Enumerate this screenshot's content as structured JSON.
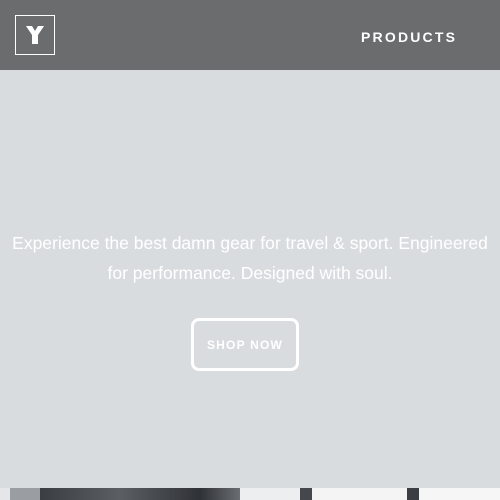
{
  "header": {
    "logo_icon": "brand-y-logo-icon",
    "nav": {
      "products_label": "PRODUCTS"
    },
    "background_color": "#6b6c6e"
  },
  "hero": {
    "tagline": "Experience the best damn gear for travel & sport. Engineered for performance. Designed with soul.",
    "cta_label": "SHOP NOW",
    "background_color": "#d9dcdf"
  }
}
